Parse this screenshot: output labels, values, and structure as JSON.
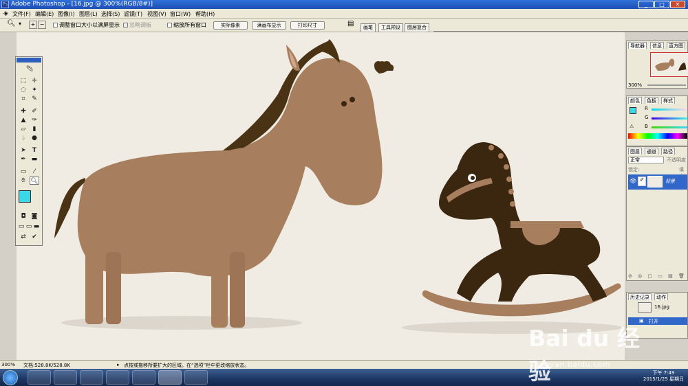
{
  "window": {
    "title": "Adobe Photoshop - [16.jpg @ 300%(RGB/8#)]",
    "minimize": "_",
    "maximize": "□",
    "close": "✕"
  },
  "menu": [
    "文件(F)",
    "编辑(E)",
    "图像(I)",
    "图层(L)",
    "选择(S)",
    "滤镜(T)",
    "视图(V)",
    "窗口(W)",
    "帮助(H)"
  ],
  "options": {
    "resize_window": "调整窗口大小以满屏显示",
    "ignore_palettes": "忽略调板",
    "zoom_all_windows": "缩放所有窗口",
    "actual_pixels": "实际像素",
    "fit_on_screen": "满画布显示",
    "print_size": "打印尺寸",
    "tab_brushes": "画笔",
    "tab_tool_presets": "工具预设",
    "tab_layer_comps": "图层复合"
  },
  "panels": {
    "navigator_tabs": [
      "导航器",
      "信息",
      "直方图"
    ],
    "nav_zoom": "300%",
    "color_tabs": [
      "颜色",
      "色板",
      "样式"
    ],
    "color_channels": [
      "R",
      "G",
      "B"
    ],
    "layers_tabs": [
      "图层",
      "通道",
      "路径"
    ],
    "blend_mode": "正常",
    "opacity_label": "不透明度",
    "lock_label": "锁定:",
    "fill_label": "填充",
    "layer_name": "背景",
    "history_tabs": [
      "历史记录",
      "动作"
    ],
    "history_items": [
      "16.jpg",
      "打开"
    ]
  },
  "status": {
    "zoom": "300%",
    "doc": "文档:528.8K/528.8K",
    "hint": "点按或拖移所要扩大的区域。在“选项”栏中更改缩放状态。"
  },
  "clock": {
    "time": "下午 7:49",
    "date": "2015/1/25 星期日"
  },
  "watermark": {
    "brand": "Bai du 经验",
    "url": "jingyan.baidu.com"
  },
  "colors": {
    "foreground": "#3cd8e8",
    "horse": "#a87f5e",
    "mane": "#4a3314",
    "rocking_horse": "#3b2710",
    "canvas": "#f0ece4"
  }
}
